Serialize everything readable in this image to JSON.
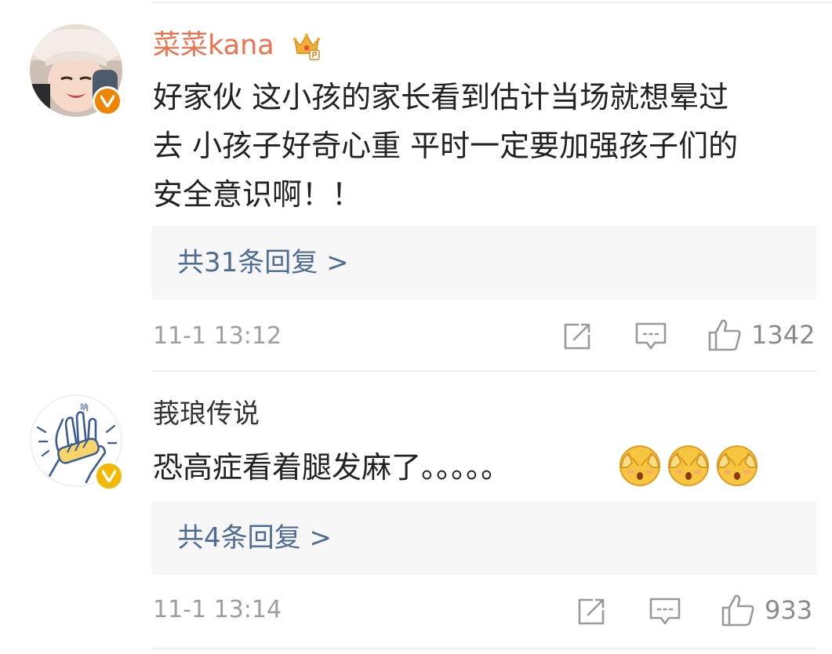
{
  "comments": [
    {
      "username": "菜菜kana",
      "text_lines": [
        "好家伙 这小孩的家长看到估计当场就想晕过",
        "去 小孩子好奇心重 平时一定要加强孩子们的",
        "安全意识啊！！"
      ],
      "reply_label": "共31条回复 >",
      "timestamp": "11-1 13:12",
      "likes": "1342",
      "verified_color": "#f08300",
      "username_color": "#eb7350"
    },
    {
      "username": "莪琅传说",
      "text": "恐高症看着腿发麻了。。。。。",
      "emojis": [
        "scared-emoji",
        "scared-emoji",
        "scared-emoji"
      ],
      "reply_label": "共4条回复 >",
      "timestamp": "11-1 13:14",
      "likes": "933",
      "verified_color": "#f5b800",
      "username_color": "#333333"
    }
  ],
  "colors": {
    "reply_link": "#4e6c91",
    "meta_text": "#9e9e9e",
    "reply_bg": "#f7f7f7"
  }
}
